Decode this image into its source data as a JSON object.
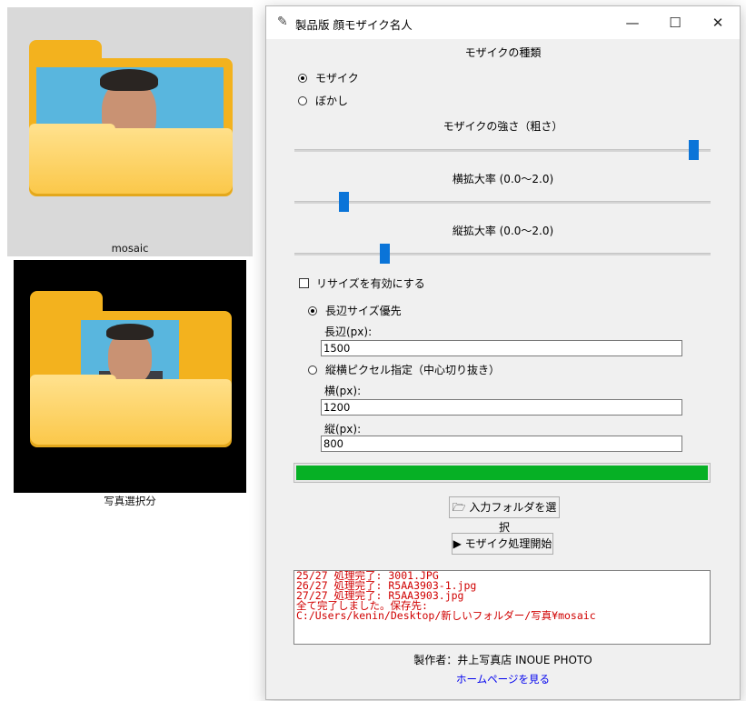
{
  "desktop": {
    "items": [
      {
        "label": "mosaic"
      },
      {
        "label": "写真選択分"
      }
    ]
  },
  "window": {
    "title": "製品版 顔モザイク名人",
    "controls": {
      "minimize": "—",
      "maximize": "☐",
      "close": "✕"
    }
  },
  "mosaic_type": {
    "heading": "モザイクの種類",
    "options": [
      {
        "label": "モザイク",
        "selected": true
      },
      {
        "label": "ぼかし",
        "selected": false
      }
    ]
  },
  "sliders": [
    {
      "label": "モザイクの強さ（粗さ）",
      "value": 0.97
    },
    {
      "label": "横拡大率 (0.0〜2.0)",
      "value": 0.11
    },
    {
      "label": "縦拡大率 (0.0〜2.0)",
      "value": 0.21
    }
  ],
  "resize": {
    "checkbox_label": "リサイズを有効にする",
    "checked": false,
    "long_side_option": {
      "label": "長辺サイズ優先",
      "selected": true
    },
    "long_side_field": {
      "label": "長辺(px):",
      "value": "1500"
    },
    "pixel_option": {
      "label": "縦横ピクセル指定（中心切り抜き）",
      "selected": false
    },
    "width_field": {
      "label": "横(px):",
      "value": "1200"
    },
    "height_field": {
      "label": "縦(px):",
      "value": "800"
    }
  },
  "progress": {
    "value": 1.0,
    "color": "#06b025"
  },
  "buttons": {
    "select_folder": "🗁 入力フォルダを選択",
    "start": "▶ モザイク処理開始"
  },
  "log": {
    "lines": [
      "25/27 処理完了: 3001.JPG",
      "26/27 処理完了: R5AA3903-1.jpg",
      "27/27 処理完了: R5AA3903.jpg",
      "全て完了しました。保存先:",
      "C:/Users/kenin/Desktop/新しいフォルダー/写真¥mosaic"
    ]
  },
  "footer": {
    "credit": "製作者：井上写真店 INOUE PHOTO",
    "link": "ホームページを見る"
  }
}
